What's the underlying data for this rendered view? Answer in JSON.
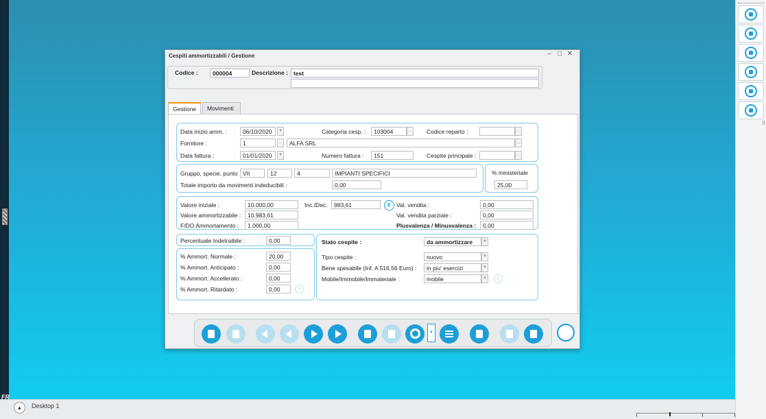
{
  "window": {
    "title": "Cespiti ammortizzabili / Gestione",
    "minimize": "–",
    "maximize": "□",
    "close": "✕"
  },
  "header": {
    "codice_label": "Codice :",
    "codice_value": "000004",
    "descrizione_label": "Descrizione :",
    "descrizione_value": "test",
    "descrizione_value2": ""
  },
  "tabs": [
    {
      "label": "Gestione",
      "active": true
    },
    {
      "label": "Movimenti",
      "active": false
    }
  ],
  "general": {
    "data_inizio_label": "Data inizio amm. :",
    "data_inizio_value": "06/10/2020",
    "categoria_label": "Categoria cesp. :",
    "categoria_value": "103004",
    "codice_reparto_label": "Codice reparto :",
    "codice_reparto_value": "",
    "fornitore_label": "Fornitore :",
    "fornitore_code": "1",
    "fornitore_name": "ALFA SRL",
    "data_fattura_label": "Data fattura :",
    "data_fattura_value": "01/01/2020",
    "numero_fattura_label": "Numero fattura :",
    "numero_fattura_value": "151",
    "cespite_principale_label": "Cespite principale :",
    "cespite_principale_value": ""
  },
  "gruppo": {
    "label": "Gruppo, specie, punto",
    "gruppo_value": "VII",
    "specie_value": "12",
    "punto_value": "4",
    "descr_value": "IMPIANTI SPECIFICI",
    "totale_label": "Totale importo da movimenti indeducibili :",
    "totale_value": "0,00",
    "ministeriale_label": "% ministeriale",
    "ministeriale_value": "25,00"
  },
  "valori": {
    "valore_iniziale_label": "Valore iniziale :",
    "valore_iniziale_value": "10.000,00",
    "inc_dec_label": "Inc./Dec.",
    "inc_dec_value": "983,61",
    "e_button": "E",
    "valore_ammortizzabile_label": "Valore ammortizzabile :",
    "valore_ammortizzabile_value": "10.983,61",
    "fdo_label": "F/DO Ammortamento :",
    "fdo_value": "1.000,00",
    "val_vendita_label": "Val. vendita :",
    "val_vendita_value": "0,00",
    "val_vendita_parziale_label": "Val. vendita parziale :",
    "val_vendita_parziale_value": "0,00",
    "plusvalenza_label": "Plusvalenza / Minusvalenza :",
    "plusvalenza_value": "0,00"
  },
  "percentuali": {
    "indetraibile_label": "Percentuale Indetraibile :",
    "indetraibile_value": "0,00",
    "normale_label": "% Ammort. Normale :",
    "normale_value": "20,00",
    "anticipato_label": "% Ammort. Anticipato :",
    "anticipato_value": "0,00",
    "accellerato_label": "% Ammort. Accellerato :",
    "accellerato_value": "0,00",
    "ritardato_label": "% Ammort. Ritardato :",
    "ritardato_value": "0,00"
  },
  "stato": {
    "stato_label": "Stato cespite :",
    "stato_value": "da ammortizzare",
    "tipo_label": "Tipo cespite :",
    "tipo_value": "nuovo",
    "bene_label": "Bene spesabile (Inf. A 516,56 Euro) :",
    "bene_value": "in piu' esercizi",
    "mobile_label": "Mobile/Immobile/Immateriale :",
    "mobile_value": "mobile"
  },
  "toolbar": {
    "buttons": [
      {
        "name": "new-record-icon",
        "enabled": true
      },
      {
        "name": "undo-icon",
        "enabled": false
      },
      {
        "name": "first-record-icon",
        "enabled": false
      },
      {
        "name": "previous-record-icon",
        "enabled": false
      },
      {
        "name": "next-record-icon",
        "enabled": true
      },
      {
        "name": "last-record-icon",
        "enabled": true
      },
      {
        "name": "duplicate-icon",
        "enabled": true
      },
      {
        "name": "save-icon",
        "enabled": false
      },
      {
        "name": "search-icon",
        "enabled": true
      },
      {
        "name": "list-icon",
        "enabled": true
      },
      {
        "name": "delete-icon",
        "enabled": true
      },
      {
        "name": "export-icon",
        "enabled": false
      },
      {
        "name": "exit-icon",
        "enabled": true
      }
    ]
  },
  "taskbar": {
    "desktop_label": "Desktop 1",
    "fr_label": "FR"
  },
  "accent_color": "#1c9fd8"
}
